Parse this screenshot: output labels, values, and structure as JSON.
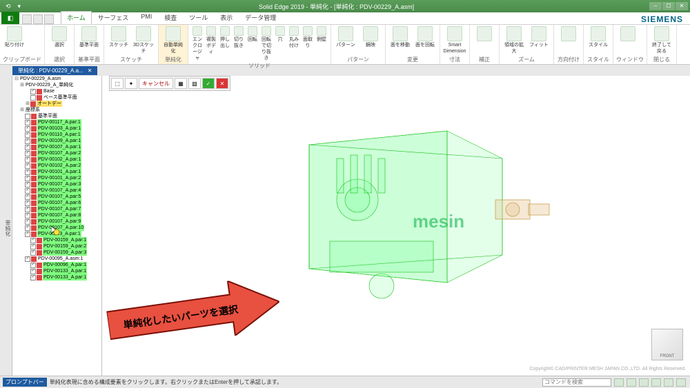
{
  "title": "Solid Edge 2019 - 単純化 - [単純化 : PDV-00229_A.asm]",
  "brand": "SIEMENS",
  "tabs": [
    "ホーム",
    "サーフェス",
    "PMI",
    "検査",
    "ツール",
    "表示",
    "データ管理"
  ],
  "activeTab": "ホーム",
  "ribbon": {
    "groups": [
      {
        "label": "クリップボード",
        "btns": [
          {
            "l": "貼り付け"
          }
        ]
      },
      {
        "label": "選択",
        "btns": [
          {
            "l": "選択"
          }
        ]
      },
      {
        "label": "基準平面",
        "btns": [
          {
            "l": "基準平面"
          }
        ]
      },
      {
        "label": "スケッチ",
        "btns": [
          {
            "l": "スケッチ"
          },
          {
            "l": "3Dスケッチ"
          }
        ]
      },
      {
        "label": "単純化",
        "highlight": true,
        "btns": [
          {
            "l": "自動単純化"
          }
        ]
      },
      {
        "label": "ソリッド",
        "btns": [
          {
            "l": "エンクロージャ"
          },
          {
            "l": "複製ボディ"
          },
          {
            "l": "押し出し"
          },
          {
            "l": "切り抜き"
          },
          {
            "l": "回転"
          },
          {
            "l": "回転で切り抜き"
          },
          {
            "l": "穴"
          },
          {
            "l": "丸み付け"
          },
          {
            "l": "面取り"
          },
          {
            "l": "側壁"
          }
        ]
      },
      {
        "label": "パターン",
        "btns": [
          {
            "l": "パターン"
          },
          {
            "l": "鏡映"
          }
        ]
      },
      {
        "label": "変更",
        "btns": [
          {
            "l": "面を移動"
          },
          {
            "l": "面を回転"
          }
        ]
      },
      {
        "label": "寸法",
        "btns": [
          {
            "l": "Smart Dimension"
          }
        ]
      },
      {
        "label": "補正",
        "btns": [
          {
            "l": ""
          }
        ]
      },
      {
        "label": "ズーム",
        "btns": [
          {
            "l": "領域の拡大"
          },
          {
            "l": "フィット"
          }
        ]
      },
      {
        "label": "方向付け",
        "btns": [
          {
            "l": ""
          }
        ]
      },
      {
        "label": "スタイル",
        "btns": [
          {
            "l": "スタイル"
          }
        ]
      },
      {
        "label": "ウィンドウ",
        "btns": [
          {
            "l": ""
          }
        ]
      },
      {
        "label": "閉じる",
        "btns": [
          {
            "l": "終了して戻る"
          }
        ]
      }
    ]
  },
  "docTab": {
    "label": "単純化 : PDV-00229_A.a..."
  },
  "floatToolbar": {
    "cancel": "キャンセル"
  },
  "tree": {
    "root": "PDV-00229_A.asm",
    "nodes": [
      {
        "t": "PDV-00229_A_単純化",
        "i": 1,
        "bold": true
      },
      {
        "t": "Base",
        "i": 2,
        "chk": true
      },
      {
        "t": "ベース基準平面",
        "i": 2,
        "chk": false
      },
      {
        "t": "オートデー",
        "i": 2,
        "yl": true
      },
      {
        "t": "座標系",
        "i": 1
      },
      {
        "t": "基準平面",
        "i": 1,
        "chk": false
      },
      {
        "t": "PDV-00117_A.par:1",
        "i": 1,
        "hl": true,
        "chk": true
      },
      {
        "t": "PDV-00103_A.par:1",
        "i": 1,
        "hl": true,
        "chk": true
      },
      {
        "t": "PDV-00110_A.par:1",
        "i": 1,
        "hl": true,
        "chk": true
      },
      {
        "t": "PDV-00109_A.par:1",
        "i": 1,
        "hl": true,
        "chk": true
      },
      {
        "t": "PDV-00107_A.par:1",
        "i": 1,
        "hl": true,
        "chk": true
      },
      {
        "t": "PDV-00107_A.par:2",
        "i": 1,
        "hl": true,
        "chk": true
      },
      {
        "t": "PDV-00102_A.par:1",
        "i": 1,
        "hl": true,
        "chk": true
      },
      {
        "t": "PDV-00102_A.par:2",
        "i": 1,
        "hl": true,
        "chk": true
      },
      {
        "t": "PDV-00101_A.par:1",
        "i": 1,
        "hl": true,
        "chk": true
      },
      {
        "t": "PDV-00101_A.par:2",
        "i": 1,
        "hl": true,
        "chk": true
      },
      {
        "t": "PDV-00107_A.par:3",
        "i": 1,
        "hl": true,
        "chk": true
      },
      {
        "t": "PDV-00107_A.par:4",
        "i": 1,
        "hl": true,
        "chk": true
      },
      {
        "t": "PDV-00107_A.par:5",
        "i": 1,
        "hl": true,
        "chk": true
      },
      {
        "t": "PDV-00107_A.par:6",
        "i": 1,
        "hl": true,
        "chk": true
      },
      {
        "t": "PDV-00107_A.par:7",
        "i": 1,
        "hl": true,
        "chk": true
      },
      {
        "t": "PDV-00107_A.par:8",
        "i": 1,
        "hl": true,
        "chk": true
      },
      {
        "t": "PDV-00107_A.par:9",
        "i": 1,
        "hl": true,
        "chk": true
      },
      {
        "t": "PDV-00107_A.par:10",
        "i": 1,
        "hl": true,
        "chk": true
      },
      {
        "t": "PDV-00113_A.par:1",
        "i": 1,
        "hl": true,
        "chk": true
      },
      {
        "t": "PDV-00159_A.par:1",
        "i": 2,
        "hl": true,
        "chk": true
      },
      {
        "t": "PDV-00159_A.par:2",
        "i": 2,
        "hl": true,
        "chk": true
      },
      {
        "t": "PDV-00159_A.par:3",
        "i": 2,
        "hl": true,
        "chk": true
      },
      {
        "t": "PDV-00095_A.asm:1",
        "i": 1,
        "chk": true
      },
      {
        "t": "PDV-00096_A.par:1",
        "i": 2,
        "hl": true,
        "chk": true
      },
      {
        "t": "PDV-00133_A.par:1",
        "i": 2,
        "hl": true,
        "chk": true
      },
      {
        "t": "PDV-00133_A.par:1",
        "i": 2,
        "hl": true,
        "chk": true
      }
    ]
  },
  "callout": "単純化したいパーツを選択",
  "viewcube": "FRONT",
  "modelLabel": "mesin",
  "copyright": "Copyright© CAD/PRINTER MESH JAPAN CO.,LTD. All Rights Reserved.",
  "status": {
    "promptLabel": "プロンプトバー",
    "promptText": "単純化表現に含める構成要素をクリックします。右クリックまたはEnterを押して承認します。",
    "searchPlaceholder": "コマンドを検索"
  },
  "leftbarLabel": "単純化"
}
